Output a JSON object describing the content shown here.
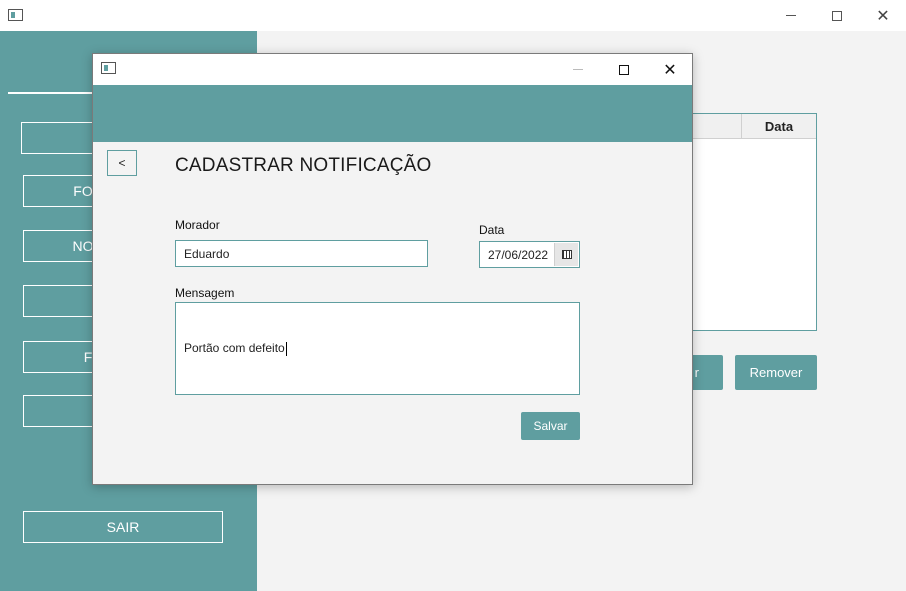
{
  "main_window": {
    "sidebar": {
      "buttons": [
        {
          "label": ""
        },
        {
          "label": "FO"
        },
        {
          "label": "NO"
        },
        {
          "label": ""
        },
        {
          "label": "F"
        },
        {
          "label": ""
        }
      ],
      "exit_label": "SAIR"
    },
    "grid": {
      "columns": [
        "",
        "Data"
      ]
    },
    "buttons": {
      "partial_label": "r",
      "remove_label": "Remover"
    }
  },
  "dialog": {
    "back_label": "<",
    "title": "CADASTRAR NOTIFICAÇÃO",
    "morador": {
      "label": "Morador",
      "value": "Eduardo"
    },
    "data": {
      "label": "Data",
      "value": "27/06/2022"
    },
    "mensagem": {
      "label": "Mensagem",
      "value": "Portão com defeito"
    },
    "save_label": "Salvar"
  },
  "colors": {
    "accent": "#5f9ea0",
    "background": "#f3f3f3",
    "titlebar": "#ffffff"
  },
  "icons": [
    "app-icon",
    "minimize-icon",
    "maximize-icon",
    "close-icon",
    "calendar-icon"
  ]
}
